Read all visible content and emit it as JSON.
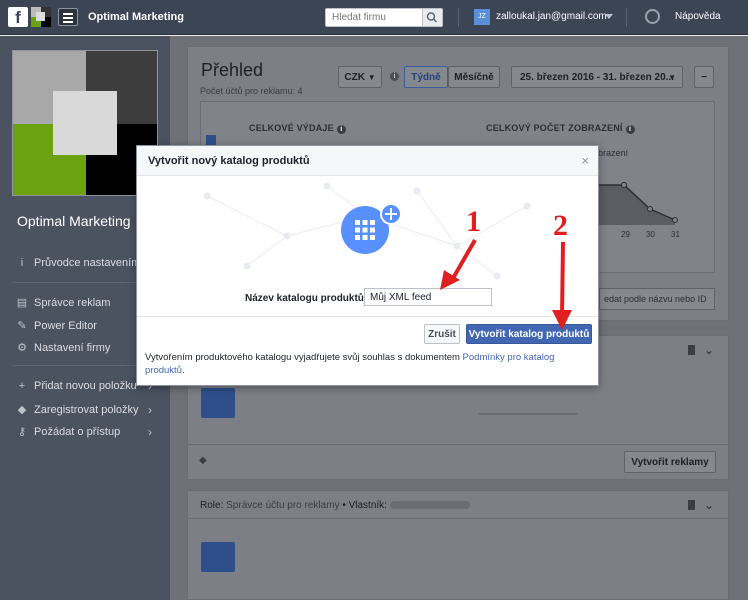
{
  "topbar": {
    "brand": "Optimal Marketing",
    "search_placeholder": "Hledat firmu",
    "avatar_initials": "JZ",
    "user_email": "zalloukal.jan@gmail.com",
    "help": "Nápověda"
  },
  "sidebar": {
    "account_name": "Optimal Marketing",
    "guide": "Průvodce nastavením",
    "items": [
      {
        "label": "Správce reklam"
      },
      {
        "label": "Power Editor"
      },
      {
        "label": "Nastavení firmy"
      }
    ],
    "items2": [
      {
        "label": "Přidat novou položku"
      },
      {
        "label": "Zaregistrovat položky"
      },
      {
        "label": "Požádat o přístup"
      }
    ]
  },
  "overview": {
    "title": "Přehled",
    "subtitle": "Počet účtů pro reklamu: 4",
    "currency": "CZK",
    "weekly": "Týdně",
    "monthly": "Měsíčně",
    "date_range": "25. březen 2016 - 31. březen 20...",
    "collapse": "−",
    "kpi_spend": "CELKOVÉ VÝDAJE",
    "kpi_impressions": "CELKOVÝ POČET ZOBRAZENÍ",
    "kpi_impressions_sub": "brazení",
    "axis_days": [
      "29",
      "30",
      "31"
    ],
    "search_by_name": "edat podle názvu nebo ID"
  },
  "cards": {
    "create_ad": "Vytvořit reklamy",
    "role_label": "Role:",
    "role_value": "Správce účtu pro reklamy",
    "owner_label": "• Vlastník:"
  },
  "modal": {
    "title": "Vytvořit nový katalog produktů",
    "close": "×",
    "field_label": "Název katalogu produktů",
    "field_value": "Můj XML feed",
    "cancel": "Zrušit",
    "create": "Vytvořit katalog produktů",
    "note_text": "Vytvořením produktového katalogu vyjadřujete svůj souhlas s dokumentem ",
    "note_link": "Podmínky pro katalog produktů",
    "note_end": "."
  },
  "annotations": {
    "step1": "1",
    "step2": "2"
  },
  "colors": {
    "topbar": "#3b4554",
    "sidebar": "#4b5260",
    "primary": "#4267b2",
    "annotation": "#e02020"
  }
}
